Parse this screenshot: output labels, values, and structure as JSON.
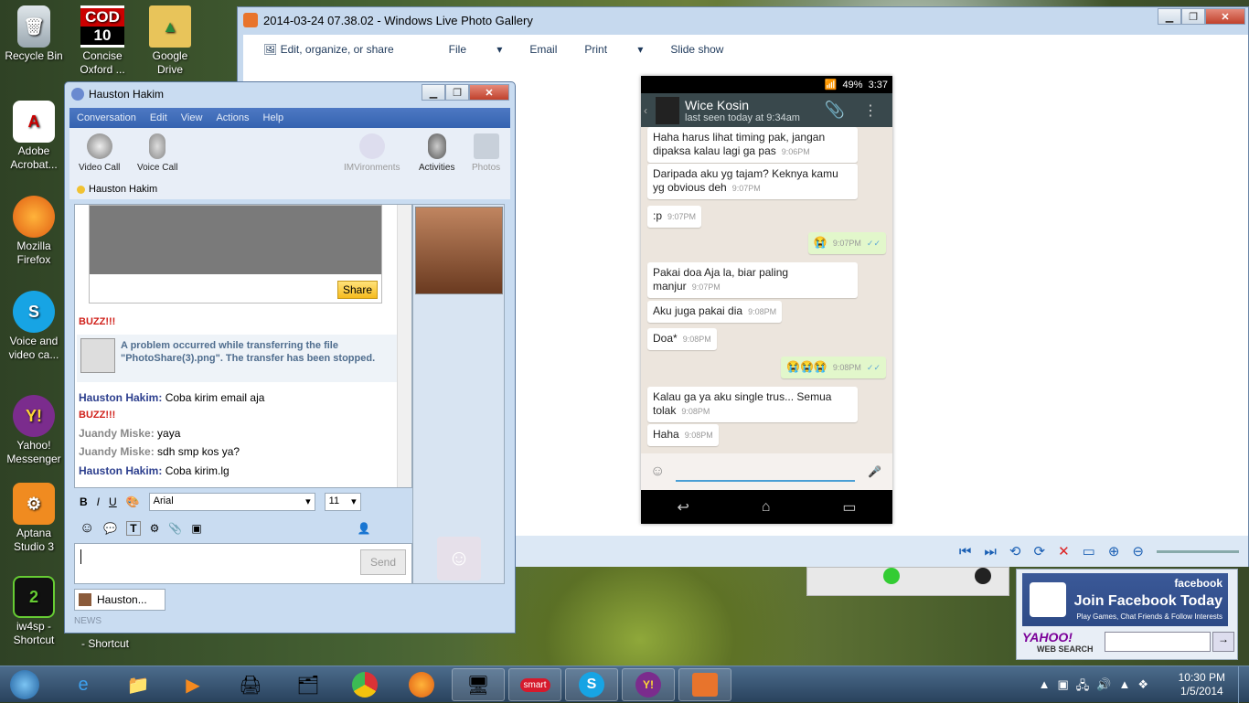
{
  "desktop": {
    "icons": [
      {
        "label": "Recycle Bin",
        "icon": "recycle-bin-icon"
      },
      {
        "label": "Concise Oxford ...",
        "icon": "cod-icon",
        "badge_top": "COD",
        "badge_bottom": "10"
      },
      {
        "label": "Google Drive",
        "icon": "google-drive-icon"
      },
      {
        "label": "Adobe Acrobat...",
        "icon": "adobe-acrobat-icon"
      },
      {
        "label": "Mozilla Firefox",
        "icon": "firefox-icon"
      },
      {
        "label": "Voice and video ca...",
        "icon": "skype-icon"
      },
      {
        "label": "Yahoo! Messenger",
        "icon": "yahoo-messenger-icon"
      },
      {
        "label": "Aptana Studio 3",
        "icon": "aptana-icon"
      },
      {
        "label": "iw4sp - Shortcut",
        "icon": "iw4sp-icon"
      },
      {
        "label": "- Shortcut",
        "icon": ""
      }
    ]
  },
  "photo_gallery": {
    "title": "2014-03-24 07.38.02 - Windows Live Photo Gallery",
    "menu": [
      "Edit, organize, or share",
      "File",
      "Email",
      "Print",
      "Slide show"
    ]
  },
  "phone": {
    "time": "3:37",
    "battery": "49%",
    "contact": "Wice Kosin",
    "last_seen": "last seen today at 9:34am",
    "messages": [
      {
        "text": "Haha harus lihat timing pak, jangan dipaksa kalau lagi ga pas",
        "time": "9:06PM",
        "out": false
      },
      {
        "text": "Daripada aku yg tajam? Keknya kamu yg obvious deh",
        "time": "9:07PM",
        "out": false
      },
      {
        "text": ":p",
        "time": "9:07PM",
        "out": false
      },
      {
        "text": "😭",
        "time": "9:07PM",
        "out": true
      },
      {
        "text": "Pakai doa Aja la, biar paling manjur",
        "time": "9:07PM",
        "out": false
      },
      {
        "text": "Aku juga pakai dia",
        "time": "9:08PM",
        "out": false
      },
      {
        "text": "Doa*",
        "time": "9:08PM",
        "out": false
      },
      {
        "text": "😭😭😭",
        "time": "9:08PM",
        "out": true
      },
      {
        "text": "Kalau ga ya aku single trus... Semua tolak",
        "time": "9:08PM",
        "out": false
      },
      {
        "text": "Haha",
        "time": "9:08PM",
        "out": false
      }
    ]
  },
  "yahoo": {
    "title": "Hauston Hakim",
    "menu": [
      "Conversation",
      "Edit",
      "View",
      "Actions",
      "Help"
    ],
    "tools": [
      "Video Call",
      "Voice Call",
      "IMVironments",
      "Activities",
      "Photos"
    ],
    "contact": "Hauston Hakim",
    "share": "Share",
    "buzz": "BUZZ!!!",
    "error": "A problem occurred while transferring the file \"PhotoShare(3).png\". The transfer has been stopped.",
    "lines": [
      {
        "who": "Hauston Hakim:",
        "text": "Coba kirim email aja",
        "me": false
      },
      {
        "who": "",
        "text": "BUZZ!!!",
        "buzz": true
      },
      {
        "who": "Juandy Miske:",
        "text": "yaya",
        "me": true
      },
      {
        "who": "Juandy Miske:",
        "text": "sdh smp kos ya?",
        "me": true
      },
      {
        "who": "Hauston Hakim:",
        "text": "Coba kirim.lg",
        "me": false
      }
    ],
    "font": "Arial",
    "size": "11",
    "send": "Send",
    "tab": "Hauston...",
    "news": "NEWS",
    "fmt": {
      "bold": "B",
      "italic": "I",
      "underline": "U"
    }
  },
  "facebook": {
    "brand": "facebook",
    "headline": "Join Facebook Today",
    "sub": "Play Games, Chat Friends & Follow Interests",
    "search_label": "YAHOO!",
    "search_sub": "WEB SEARCH"
  },
  "taskbar": {
    "time": "10:30 PM",
    "date": "1/5/2014",
    "smart": "smart"
  }
}
